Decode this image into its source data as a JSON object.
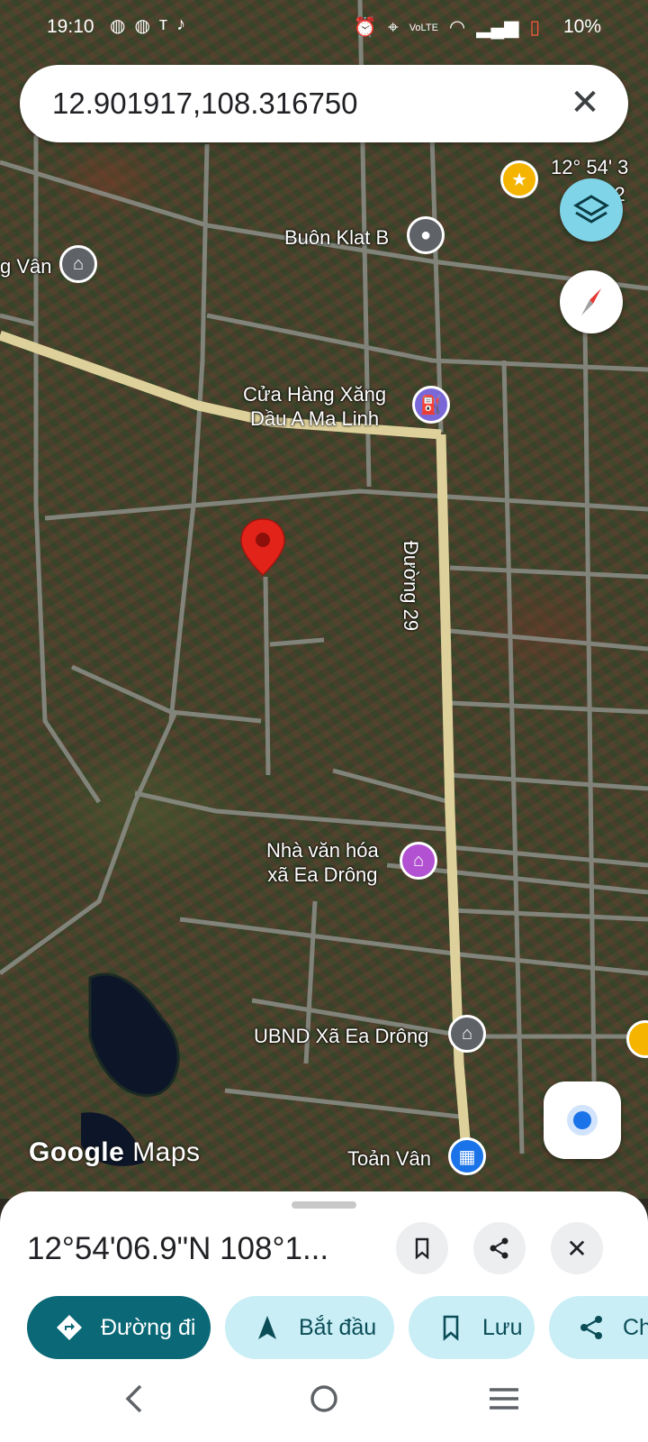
{
  "status_bar": {
    "time": "19:10",
    "battery": "10%",
    "left_icons": [
      "messenger-icon",
      "messenger-icon",
      "text-icon",
      "tiktok-icon"
    ],
    "right_icons": [
      "alarm-icon",
      "location-icon",
      "volte-icon",
      "wifi-icon",
      "signal-icon",
      "signal-icon",
      "battery-icon"
    ]
  },
  "search": {
    "value": "12.901917,108.316750"
  },
  "map": {
    "labels": {
      "buon_klat": "Buôn Klat B",
      "van": "g Vân",
      "fuel_station": "Cửa Hàng Xăng\nDầu A Ma Linh",
      "road_29": "Đường 29",
      "cultural_house": "Nhà văn hóa\nxã Ea Drông",
      "ubnd": "UBND Xã Ea Drông",
      "toan_van": "Toản Vân",
      "coord_overlay_1": "12° 54' 3",
      "coord_overlay_2": "9' 2"
    },
    "pin_color": "#e2231a",
    "road_color": "#e3d39a"
  },
  "logo": {
    "brand": "Google",
    "product": "Maps"
  },
  "sheet": {
    "title": "12°54'06.9\"N 108°1...",
    "chips": {
      "directions": "Đường đi",
      "start": "Bắt đầu",
      "save": "Lưu",
      "share": "Ch"
    }
  },
  "colors": {
    "primary_chip": "#0b6876",
    "secondary_chip": "#c9eef6",
    "layers_fab": "#7fd4e8",
    "location_dot": "#1a73e8"
  }
}
